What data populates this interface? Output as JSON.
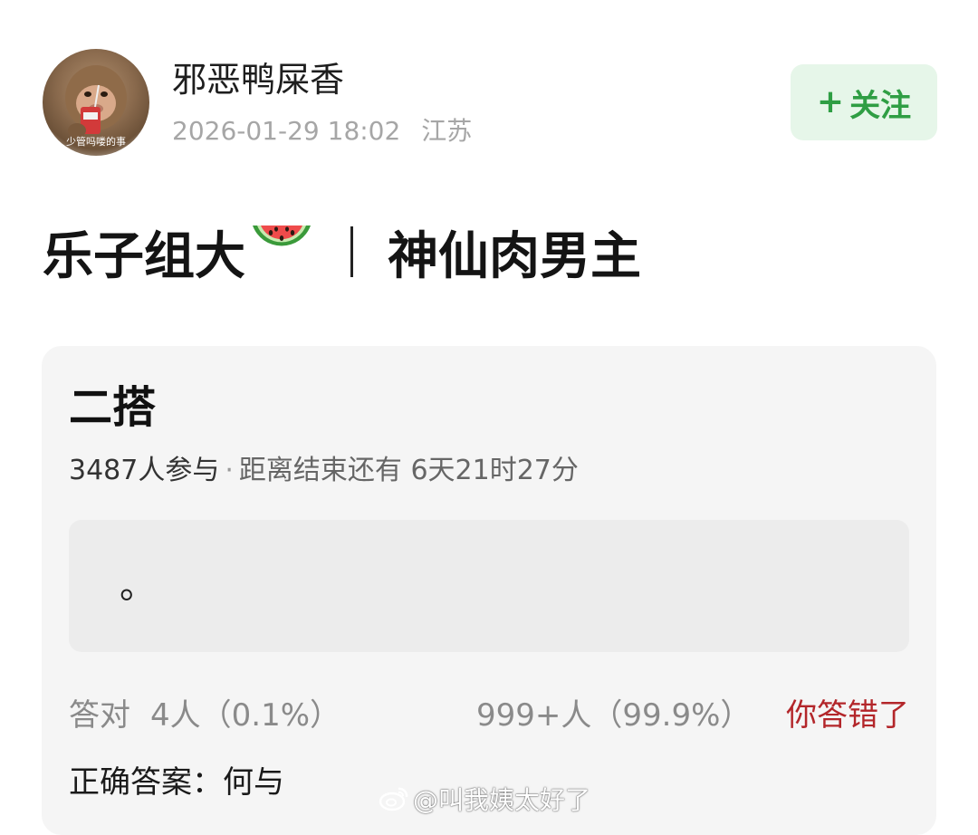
{
  "author": {
    "name": "邪恶鸭屎香",
    "avatar_caption": "少管吗喽的事",
    "avatar_icon": "monkey-drinking-avatar",
    "timestamp": "2026-01-29 18:02",
    "location": "江苏"
  },
  "follow_button": {
    "plus": "+",
    "label": "关注",
    "color": "#2f9e44",
    "background": "#e6f6e9"
  },
  "post": {
    "title_left": "乐子组大",
    "title_emoji": "watermelon-icon",
    "title_right": "神仙肉男主"
  },
  "quiz": {
    "title": "二搭",
    "participants": "3487人参与",
    "separator": "·",
    "countdown": "距离结束还有 6天21时27分",
    "option_text": "。",
    "correct_label": "答对",
    "correct_stat": "4人（0.1%）",
    "wrong_stat": "999+人（99.9%）",
    "wrong_label": "你答错了",
    "wrong_color": "#b3262a",
    "answer_label": "正确答案：",
    "answer_value": "何与"
  },
  "watermark": {
    "icon": "weibo-icon",
    "text": "@叫我姨太好了"
  }
}
